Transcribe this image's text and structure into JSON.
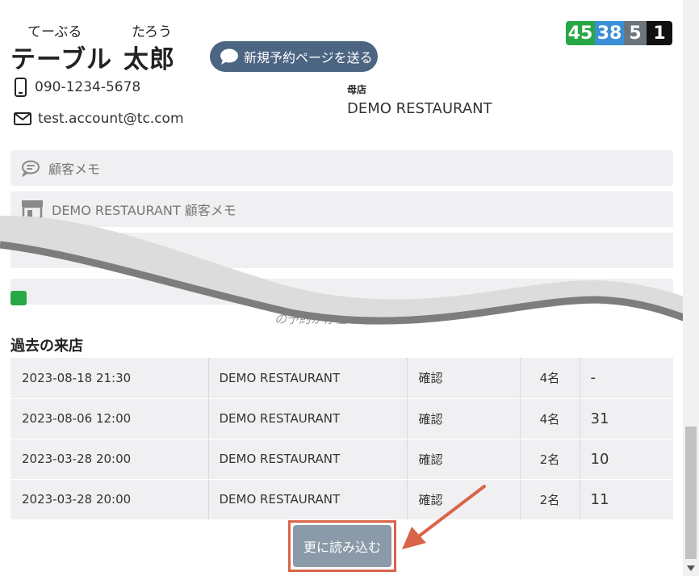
{
  "customer": {
    "last_name_reading": "てーぶる",
    "first_name_reading": "たろう",
    "last_name": "テーブル",
    "first_name": "太郎",
    "phone": "090-1234-5678",
    "email": "test.account@tc.com"
  },
  "send_button_label": "新規予約ページを送る",
  "counts": [
    {
      "value": "45",
      "color": "#28a745"
    },
    {
      "value": "38",
      "color": "#3a8fd6"
    },
    {
      "value": "5",
      "color": "#6c757d"
    },
    {
      "value": "1",
      "color": "#111111"
    }
  ],
  "home_store": {
    "label": "母店",
    "name": "DEMO RESTAURANT"
  },
  "memos": {
    "customer_memo": "顧客メモ",
    "store_memo": "DEMO RESTAURANT 顧客メモ"
  },
  "faded_notice": "の予約が存在しません",
  "past_visits": {
    "title": "過去の来店",
    "rows": [
      {
        "datetime": "2023-08-18 21:30",
        "store": "DEMO RESTAURANT",
        "status": "確認",
        "people": "4名",
        "extra": "-"
      },
      {
        "datetime": "2023-08-06 12:00",
        "store": "DEMO RESTAURANT",
        "status": "確認",
        "people": "4名",
        "extra": "31"
      },
      {
        "datetime": "2023-03-28 20:00",
        "store": "DEMO RESTAURANT",
        "status": "確認",
        "people": "2名",
        "extra": "10"
      },
      {
        "datetime": "2023-03-28 20:00",
        "store": "DEMO RESTAURANT",
        "status": "確認",
        "people": "2名",
        "extra": "11"
      }
    ]
  },
  "load_more_label": "更に読み込む",
  "colors": {
    "accent_button": "#4b6582",
    "load_more_button": "#8a9aa8",
    "highlight": "#d9644a"
  }
}
